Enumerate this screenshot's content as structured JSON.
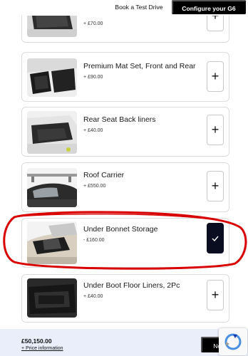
{
  "header": {
    "book_test_drive": "Book a Test Drive",
    "configure": "Configure your G6"
  },
  "accessories": [
    {
      "title": "",
      "price": "+ £70.00",
      "selected": false
    },
    {
      "title": "Premium Mat Set, Front and Rear",
      "price": "+ £90.00",
      "selected": false
    },
    {
      "title": "Rear Seat Back liners",
      "price": "+ £40.00",
      "selected": false
    },
    {
      "title": "Roof Carrier",
      "price": "+ £550.00",
      "selected": false
    },
    {
      "title": "Under Bonnet Storage",
      "price": "- £160.00",
      "selected": true
    },
    {
      "title": "Under Boot Floor Liners, 2Pc",
      "price": "+ £40.00",
      "selected": false
    }
  ],
  "footer": {
    "total": "£50,150.00",
    "price_info": "+ Price information",
    "next": "Next"
  },
  "icons": {
    "add": "plus-icon",
    "selected": "check-icon",
    "captcha": "recaptcha-icon"
  },
  "colors": {
    "selected_button": "#0a0c1f",
    "annotation_circle": "#d90000",
    "footer_background": "#e9eefa"
  }
}
